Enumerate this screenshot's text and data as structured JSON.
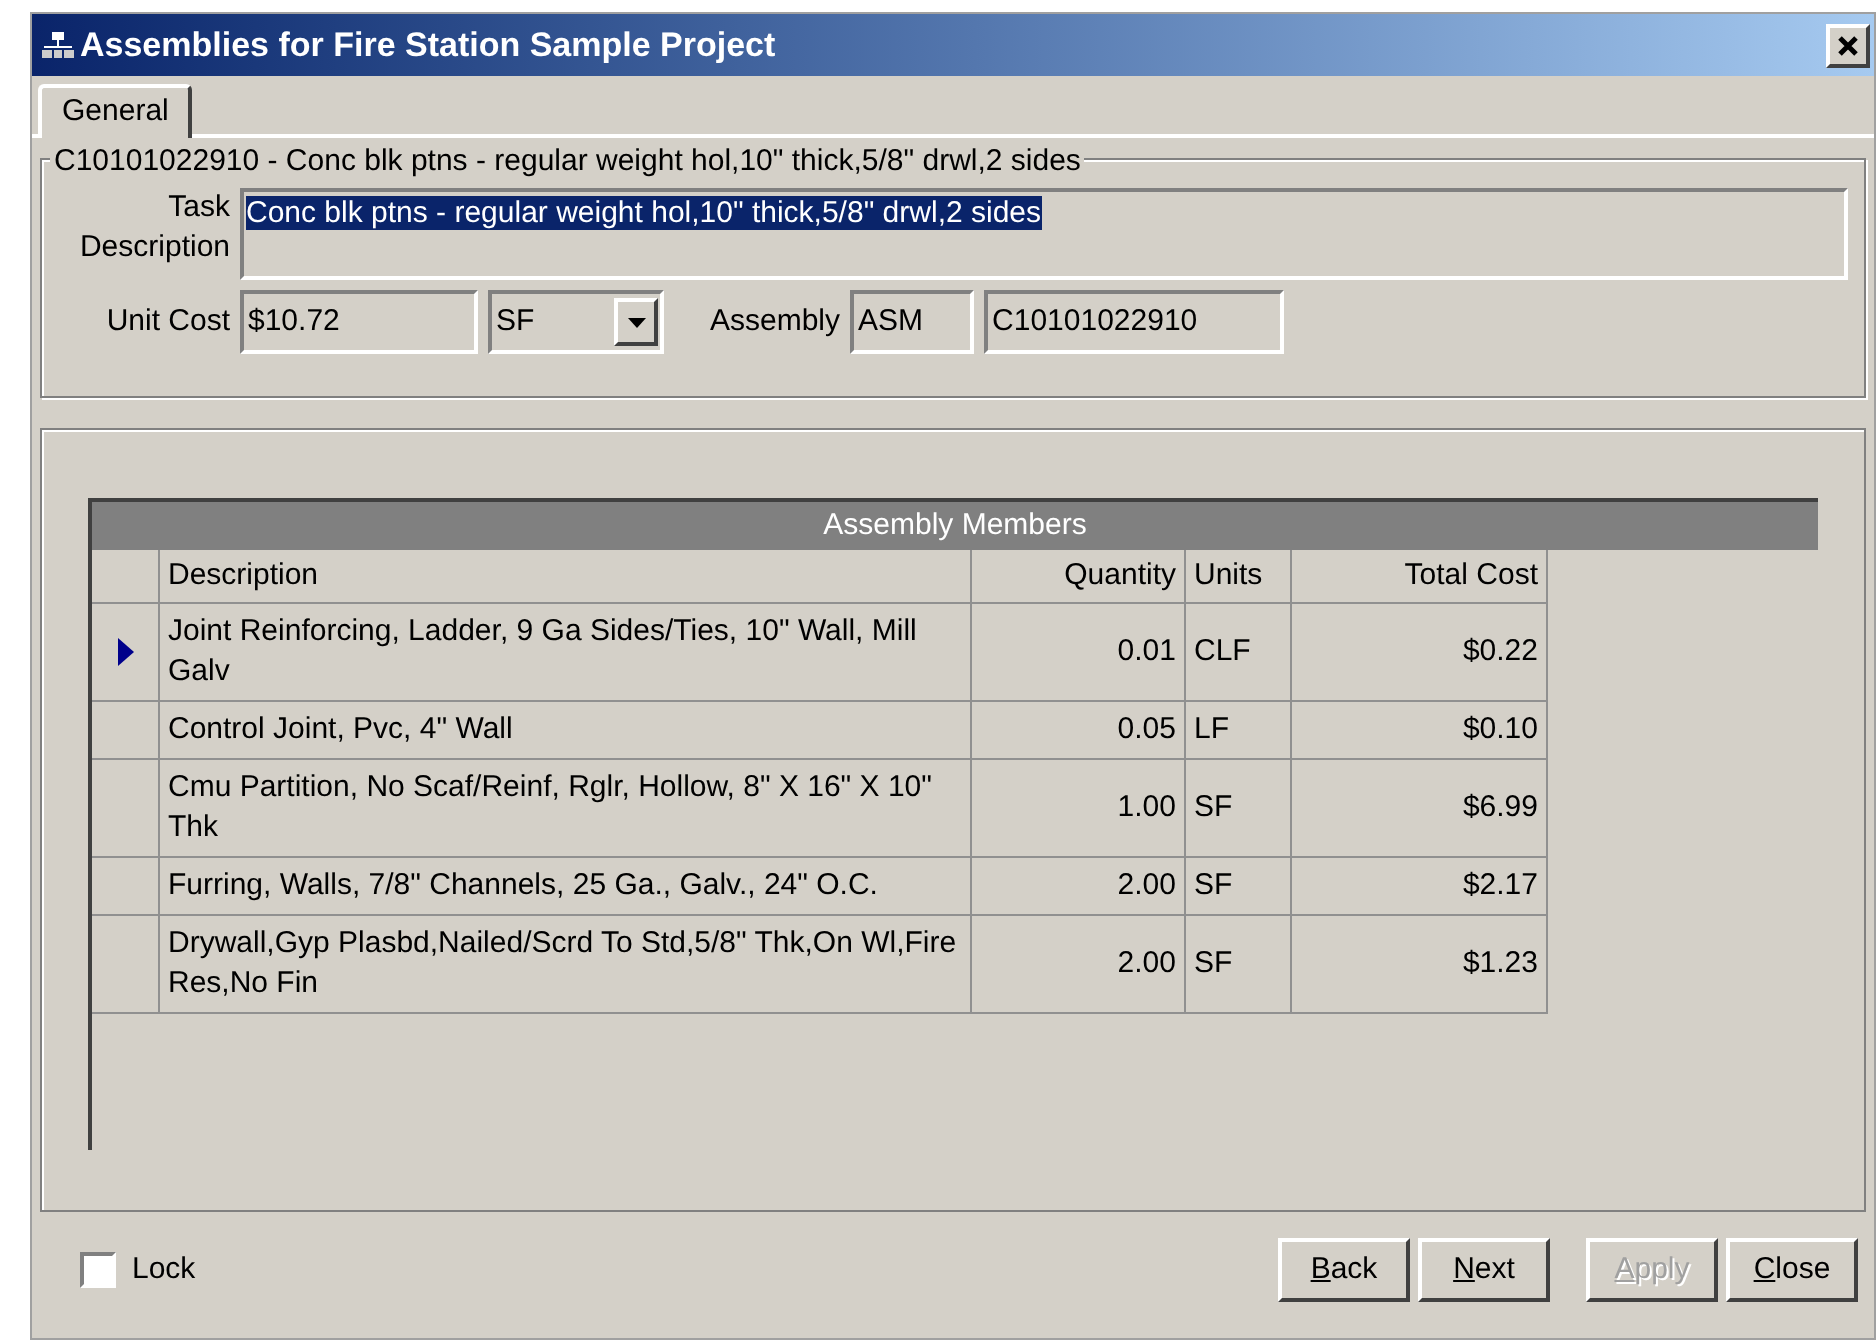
{
  "window": {
    "title": "Assemblies for Fire Station Sample Project"
  },
  "tabs": [
    {
      "label": "General",
      "selected": true
    }
  ],
  "group": {
    "title": "C10101022910 - Conc blk ptns - regular weight hol,10\" thick,5/8\" drwl,2 sides",
    "task_label": "Task Description",
    "task_value": "Conc blk ptns - regular weight hol,10\" thick,5/8\" drwl,2 sides",
    "unit_cost_label": "Unit Cost",
    "unit_cost": "$10.72",
    "unit": "SF",
    "assembly_label": "Assembly",
    "assembly_type": "ASM",
    "assembly_code": "C10101022910"
  },
  "table": {
    "title": "Assembly Members",
    "columns": [
      "Description",
      "Quantity",
      "Units",
      "Total Cost"
    ],
    "rows": [
      {
        "selected": true,
        "cells": [
          "Joint Reinforcing, Ladder, 9 Ga Sides/Ties, 10\" Wall, Mill Galv",
          "0.01",
          "CLF",
          "$0.22"
        ]
      },
      {
        "selected": false,
        "cells": [
          "Control Joint, Pvc, 4\" Wall",
          "0.05",
          "LF",
          "$0.10"
        ]
      },
      {
        "selected": false,
        "cells": [
          "Cmu Partition, No Scaf/Reinf, Rglr, Hollow, 8\" X 16\" X 10\" Thk",
          "1.00",
          "SF",
          "$6.99"
        ]
      },
      {
        "selected": false,
        "cells": [
          "Furring, Walls, 7/8\" Channels, 25 Ga., Galv., 24\" O.C.",
          "2.00",
          "SF",
          "$2.17"
        ]
      },
      {
        "selected": false,
        "cells": [
          "Drywall,Gyp Plasbd,Nailed/Scrd To Std,5/8\" Thk,On Wl,Fire Res,No Fin",
          "2.00",
          "SF",
          "$1.23"
        ]
      }
    ]
  },
  "lock": {
    "label": "Lock",
    "checked": false
  },
  "buttons": [
    {
      "label": "Back",
      "disabled": false
    },
    {
      "label": "Next",
      "disabled": false
    },
    {
      "label": "Apply",
      "disabled": true
    },
    {
      "label": "Close",
      "disabled": false
    }
  ]
}
